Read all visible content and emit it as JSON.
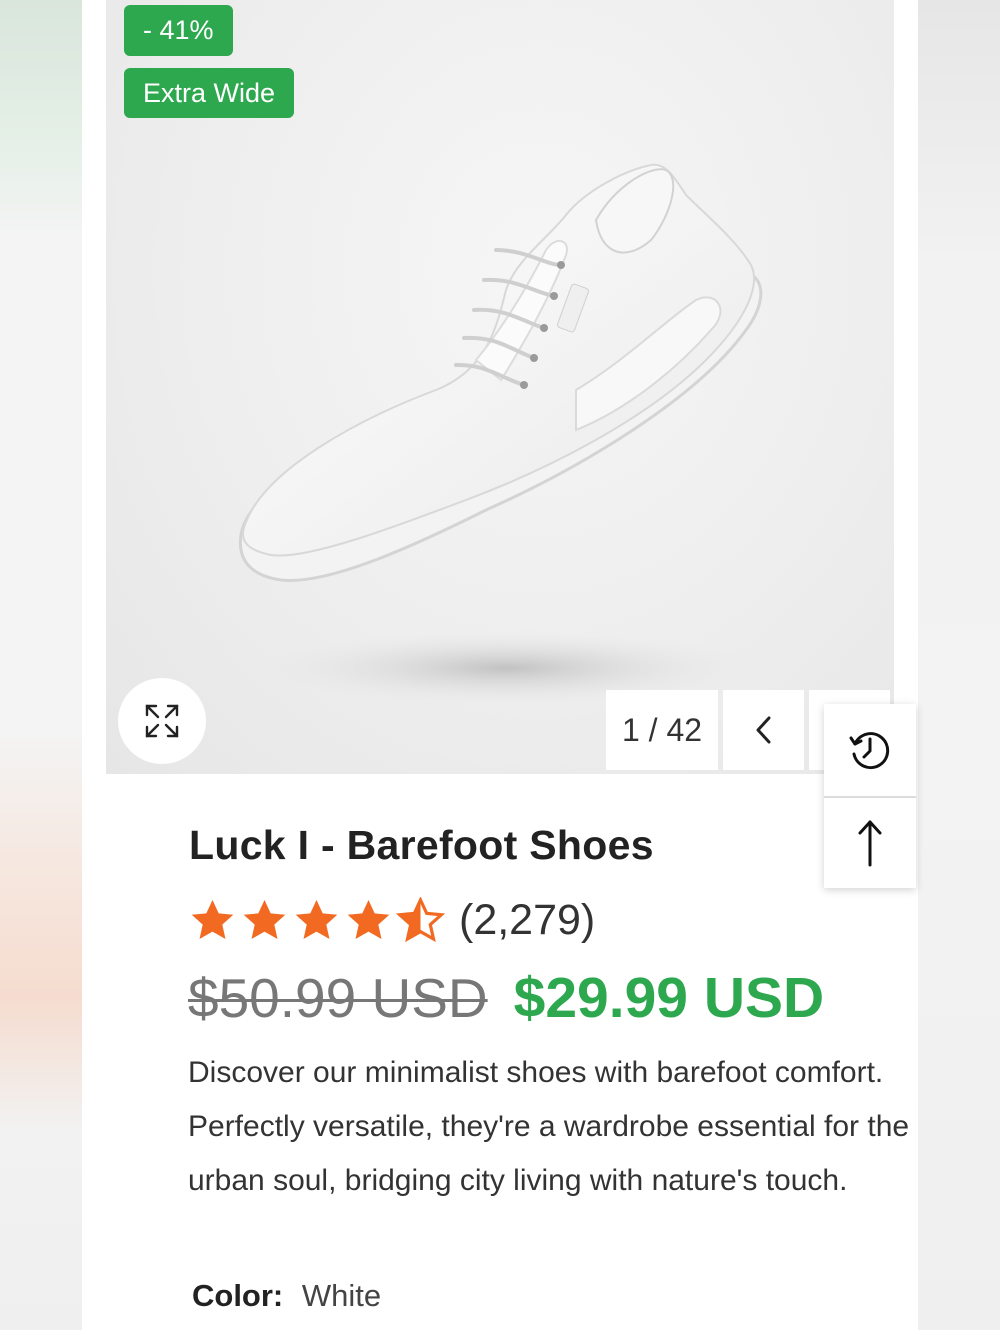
{
  "badges": {
    "discount": "- 41%",
    "width": "Extra Wide"
  },
  "gallery": {
    "counter": "1 / 42"
  },
  "product": {
    "title": "Luck I - Barefoot Shoes",
    "rating": 4.5,
    "review_count": "(2,279)",
    "old_price": "$50.99 USD",
    "new_price": "$29.99 USD",
    "description": "Discover our minimalist shoes with barefoot comfort. Perfectly versatile, they're a wardrobe essential for the urban soul, bridging city living with nature's touch.",
    "color_label": "Color:",
    "color_value": "White"
  },
  "icons": [
    "expand-icon",
    "chevron-left-icon",
    "history-icon",
    "arrow-up-icon",
    "star-icon",
    "half-star-icon"
  ],
  "colors": {
    "accent_green": "#2ea84f",
    "star_orange": "#f26a21"
  }
}
